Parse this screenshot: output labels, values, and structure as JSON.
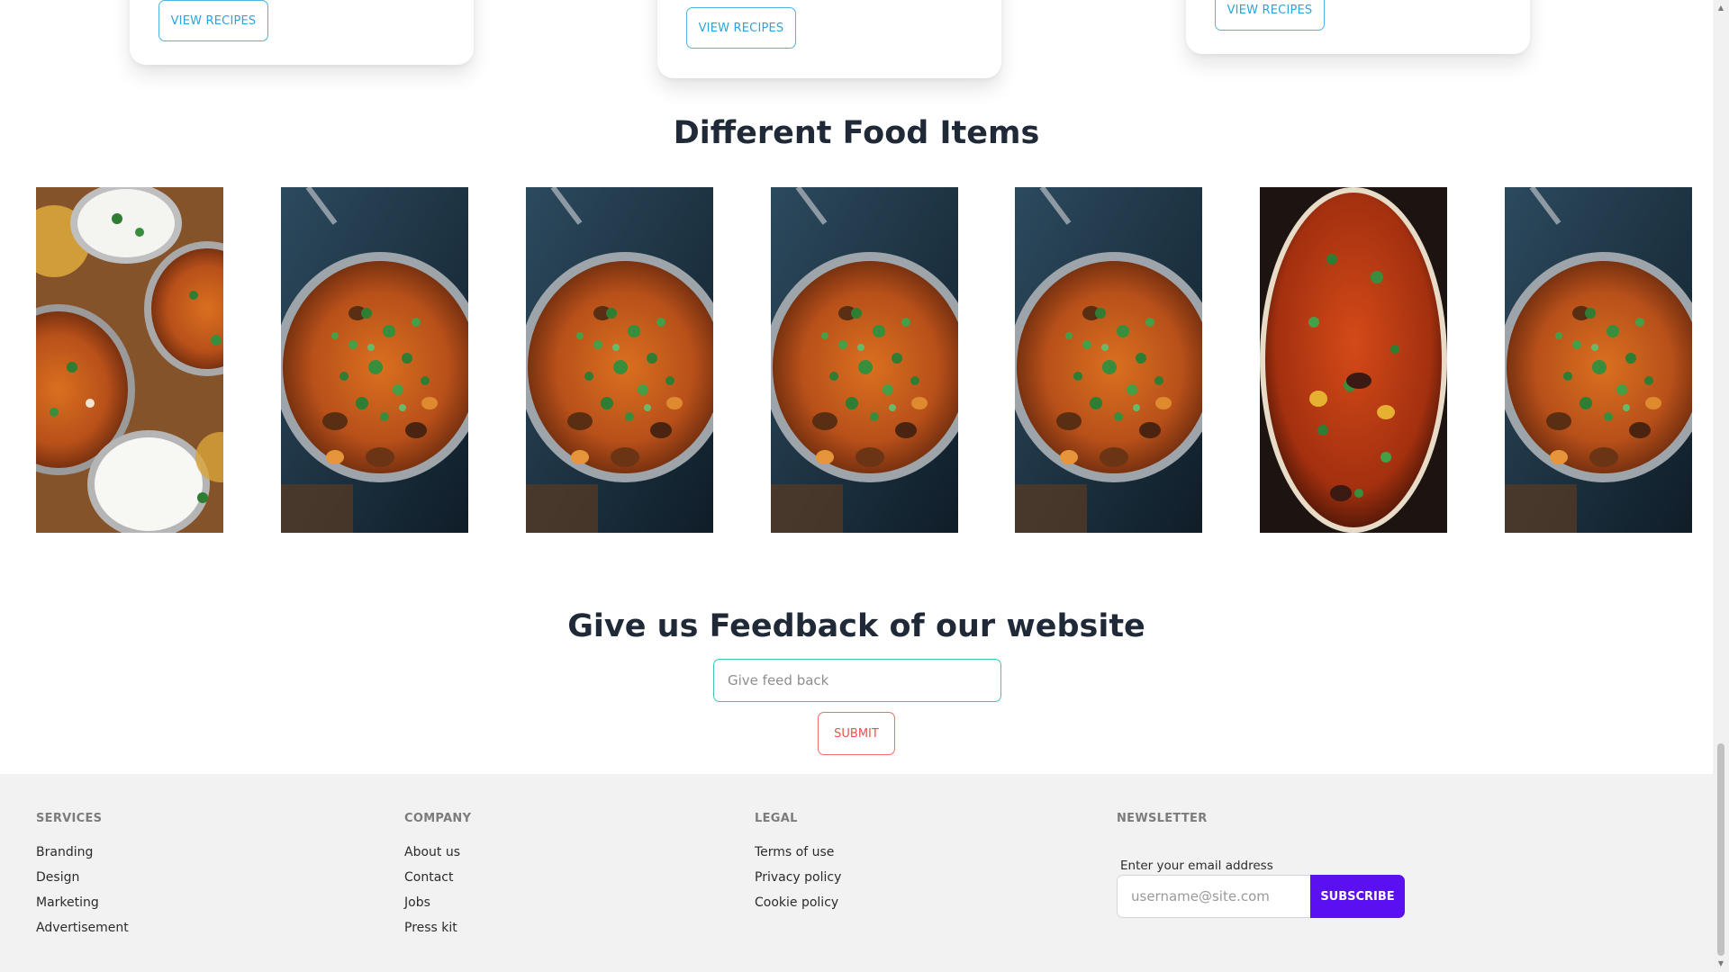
{
  "recipe_cards": [
    {
      "button_label": "VIEW RECIPES"
    },
    {
      "button_label": "VIEW RECIPES"
    },
    {
      "button_label": "VIEW RECIPES"
    }
  ],
  "food_section": {
    "title": "Different Food Items",
    "items": [
      {
        "icon": "curry-thali-photo"
      },
      {
        "icon": "curry-pan-photo"
      },
      {
        "icon": "curry-pan-photo"
      },
      {
        "icon": "curry-pan-photo"
      },
      {
        "icon": "curry-pan-photo"
      },
      {
        "icon": "curry-pot-photo"
      },
      {
        "icon": "curry-pan-photo"
      }
    ]
  },
  "feedback": {
    "title": "Give us Feedback of our website",
    "placeholder": "Give feed back",
    "submit_label": "SUBMIT"
  },
  "footer": {
    "services": {
      "heading": "SERVICES",
      "links": [
        "Branding",
        "Design",
        "Marketing",
        "Advertisement"
      ]
    },
    "company": {
      "heading": "COMPANY",
      "links": [
        "About us",
        "Contact",
        "Jobs",
        "Press kit"
      ]
    },
    "legal": {
      "heading": "LEGAL",
      "links": [
        "Terms of use",
        "Privacy policy",
        "Cookie policy"
      ]
    },
    "newsletter": {
      "heading": "NEWSLETTER",
      "label": "Enter your email address",
      "placeholder": "username@site.com",
      "button_label": "SUBSCRIBE"
    }
  },
  "colors": {
    "recipe_button": "#2ea3dc",
    "feedback_border": "#3cc7b4",
    "submit": "#ec4f4f",
    "subscribe": "#5a10f0",
    "footer_bg": "#f2f2f2"
  }
}
